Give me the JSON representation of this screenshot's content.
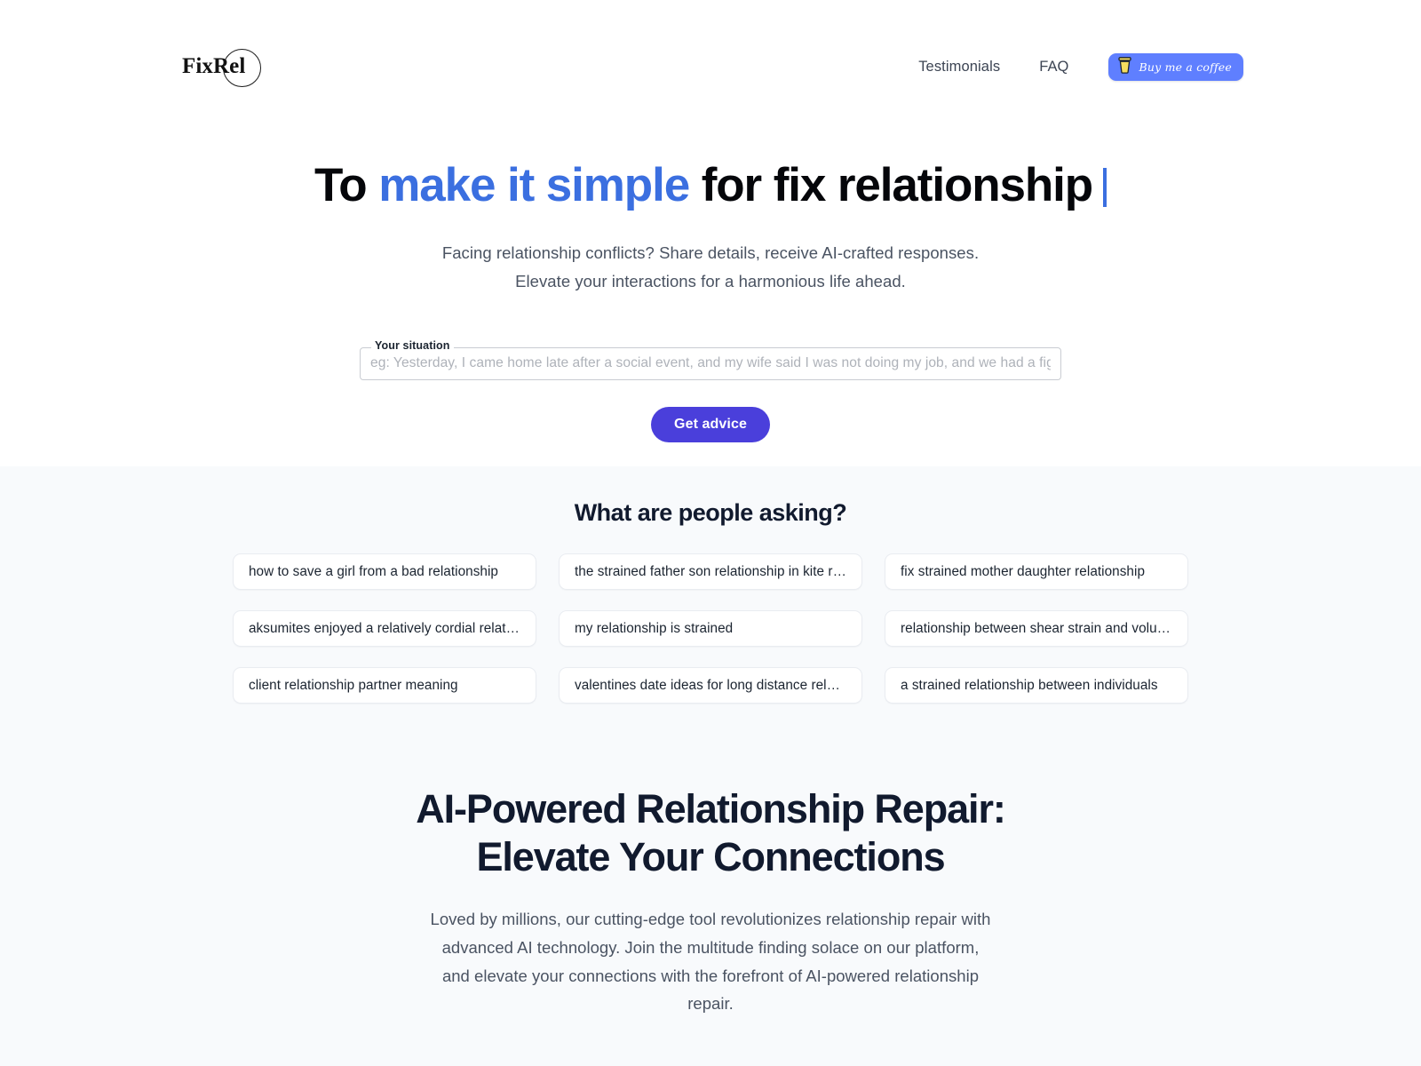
{
  "header": {
    "logo_text": "FixRel",
    "nav": [
      {
        "label": "Testimonials",
        "name": "nav-link-testimonials"
      },
      {
        "label": "FAQ",
        "name": "nav-link-faq"
      }
    ],
    "bmc_label": "Buy me a coffee"
  },
  "hero": {
    "headline_prefix": "To ",
    "headline_accent": "make it simple",
    "headline_suffix": " for fix relationship",
    "subtitle_line1": "Facing relationship conflicts? Share details, receive AI-crafted responses.",
    "subtitle_line2": "Elevate your interactions for a harmonious life ahead.",
    "field_label": "Your situation",
    "field_value": "",
    "field_placeholder": "eg: Yesterday, I came home late after a social event, and my wife said I was not doing my job, and we had a fight, so give me advice",
    "cta_label": "Get advice"
  },
  "ask": {
    "title": "What are people asking?",
    "chips": [
      "how to save a girl from a bad relationship",
      "the strained father son relationship in kite runner",
      "fix strained mother daughter relationship",
      "aksumites enjoyed a relatively cordial relationship with",
      "my relationship is strained",
      "relationship between shear strain and volumetric strain",
      "client relationship partner meaning",
      "valentines date ideas for long distance relationship",
      "a strained relationship between individuals"
    ]
  },
  "about": {
    "title_line1": "AI-Powered Relationship Repair:",
    "title_line2": "Elevate Your Connections",
    "body": "Loved by millions, our cutting-edge tool revolutionizes relationship repair with advanced AI technology. Join the multitude finding solace on our platform, and elevate your connections with the forefront of AI-powered relationship repair."
  },
  "colors": {
    "accent_blue": "#3b6fe0",
    "cta_purple": "#4a3fdb",
    "bmc_blue": "#5F7FFF",
    "section_bg": "#F8FAFC"
  }
}
